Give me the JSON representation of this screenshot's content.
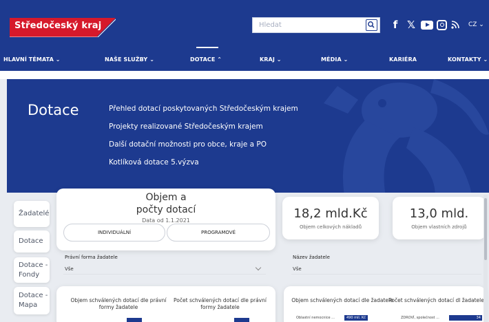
{
  "header": {
    "logo_text": "Středočeský kraj",
    "search_placeholder": "Hledat",
    "lang": "CZ ⌄",
    "social": [
      "f",
      "𝕏",
      "youtube",
      "instagram",
      "rss"
    ]
  },
  "nav": {
    "items": [
      {
        "label": "HLAVNÍ TÉMATA ⌄"
      },
      {
        "label": "NAŠE SLUŽBY ⌄"
      },
      {
        "label": "DOTACE ⌃"
      },
      {
        "label": "KRAJ ⌄"
      },
      {
        "label": "MÉDIA ⌄"
      },
      {
        "label": "KARIÉRA"
      },
      {
        "label": "KONTAKTY ⌄"
      }
    ],
    "active_index": 2
  },
  "dropdown": {
    "title": "Dotace",
    "links": [
      "Přehled dotací poskytovaných Středočeským krajem",
      "Projekty realizované Středočeským krajem",
      "Další dotační možnosti pro obce, kraje a PO",
      "Kotlíková dotace 5.výzva"
    ]
  },
  "sidebar": {
    "items": [
      {
        "label": "Žadatelé"
      },
      {
        "label": "Dotace"
      },
      {
        "label": "Dotace - Fondy"
      },
      {
        "label": "Dotace - Mapa"
      }
    ]
  },
  "main": {
    "heading": "Objem a počty dotací",
    "subheading": "Data od 1.1.2021",
    "pills": [
      "INDIVIDUÁLNÍ",
      "PROGRAMOVÉ"
    ],
    "filter1_label": "Právní forma žadatele",
    "filter1_value": "Vše",
    "filter2_label": "Název žadatele",
    "filter2_value": "Vše",
    "kpi1_value": "18,2 mld.Kč",
    "kpi1_label": "Objem celkových nákladů",
    "kpi2_value": "13,0 mld.",
    "kpi2_label": "Objem vlastních zdrojů",
    "chart1_title": "Objem schválených dotací dle právní formy žadatele",
    "chart2_title": "Počet schválených dotací dle právní formy žadatele",
    "chart3_title": "Objem schválených dotací dle žadatele",
    "chart4_title": "Počet schválených dotací dl žadatele",
    "chart3_row_label": "Oblastní nemocnice ...",
    "chart3_row_value": "490 mil. Kč",
    "chart4_row_label": "ZDROVÍ, společnost ...",
    "chart4_row_value": "34"
  },
  "colors": {
    "brand_blue": "#1d3a8f",
    "brand_red": "#d6192b",
    "page_bg": "#e9ecf1"
  }
}
